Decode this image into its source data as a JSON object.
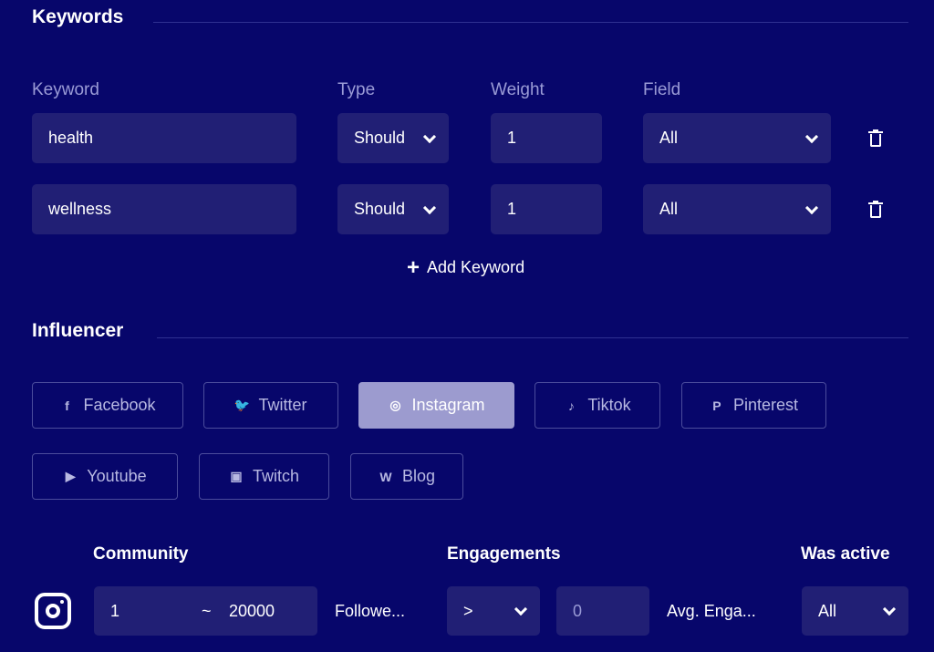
{
  "keywords": {
    "title": "Keywords",
    "col_keyword": "Keyword",
    "col_type": "Type",
    "col_weight": "Weight",
    "col_field": "Field",
    "rows": [
      {
        "keyword": "health",
        "type": "Should",
        "weight": "1",
        "field": "All"
      },
      {
        "keyword": "wellness",
        "type": "Should",
        "weight": "1",
        "field": "All"
      }
    ],
    "add_label": "Add Keyword"
  },
  "influencer": {
    "title": "Influencer",
    "platforms": [
      {
        "label": "Facebook",
        "icon": "facebook-icon",
        "active": false
      },
      {
        "label": "Twitter",
        "icon": "twitter-icon",
        "active": false
      },
      {
        "label": "Instagram",
        "icon": "instagram-icon",
        "active": true
      },
      {
        "label": "Tiktok",
        "icon": "tiktok-icon",
        "active": false
      },
      {
        "label": "Pinterest",
        "icon": "pinterest-icon",
        "active": false
      },
      {
        "label": "Youtube",
        "icon": "youtube-icon",
        "active": false
      },
      {
        "label": "Twitch",
        "icon": "twitch-icon",
        "active": false
      },
      {
        "label": "Blog",
        "icon": "wordpress-icon",
        "active": false
      }
    ]
  },
  "filters": {
    "community_label": "Community",
    "community_min": "1",
    "community_sep": "~",
    "community_max": "20000",
    "community_unit": "Followe...",
    "engagements_label": "Engagements",
    "eng_operator": ">",
    "eng_value": "0",
    "eng_unit": "Avg. Enga...",
    "was_active_label": "Was active",
    "was_active_value": "All"
  },
  "colors": {
    "background": "#07066b",
    "field": "#211f75",
    "active": "#9c9bcf"
  }
}
